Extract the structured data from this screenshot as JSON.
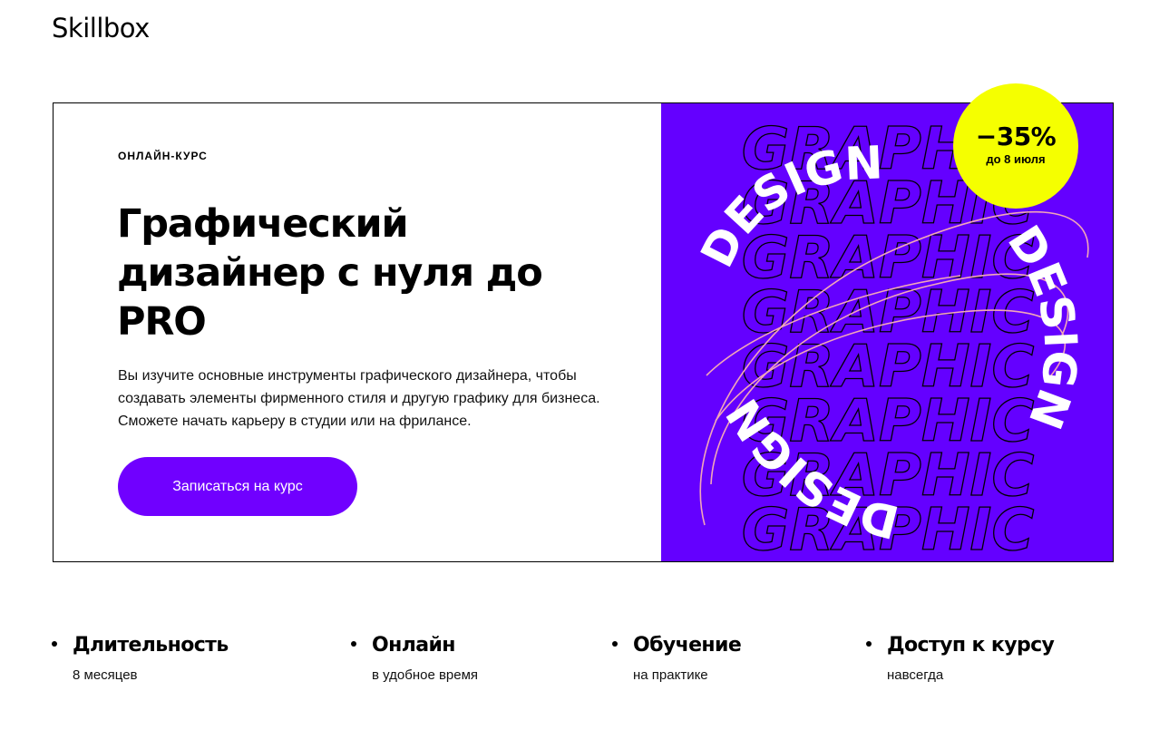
{
  "header": {
    "logo": "Skillbox"
  },
  "hero": {
    "eyebrow": "ОНЛАЙН-КУРС",
    "title": "Графический дизайнер с нуля до PRO",
    "description": "Вы изучите основные инструменты графического дизайнера, чтобы создавать элементы фирменного стиля и другую графику для бизнеса. Сможете начать карьеру в студии или на фрилансе.",
    "cta_label": "Записаться на курс",
    "background_color": "#6400ff",
    "cta_color": "#7000ff"
  },
  "artwork": {
    "outline_word": "GRAPHIC",
    "ring_word": "DESIGN"
  },
  "badge": {
    "discount": "−35%",
    "deadline": "до 8 июля",
    "color": "#f5ff00"
  },
  "features": [
    {
      "title": "Длительность",
      "text": "8 месяцев"
    },
    {
      "title": "Онлайн",
      "text": "в удобное время"
    },
    {
      "title": "Обучение",
      "text": "на практике"
    },
    {
      "title": "Доступ к курсу",
      "text": "навсегда"
    }
  ]
}
